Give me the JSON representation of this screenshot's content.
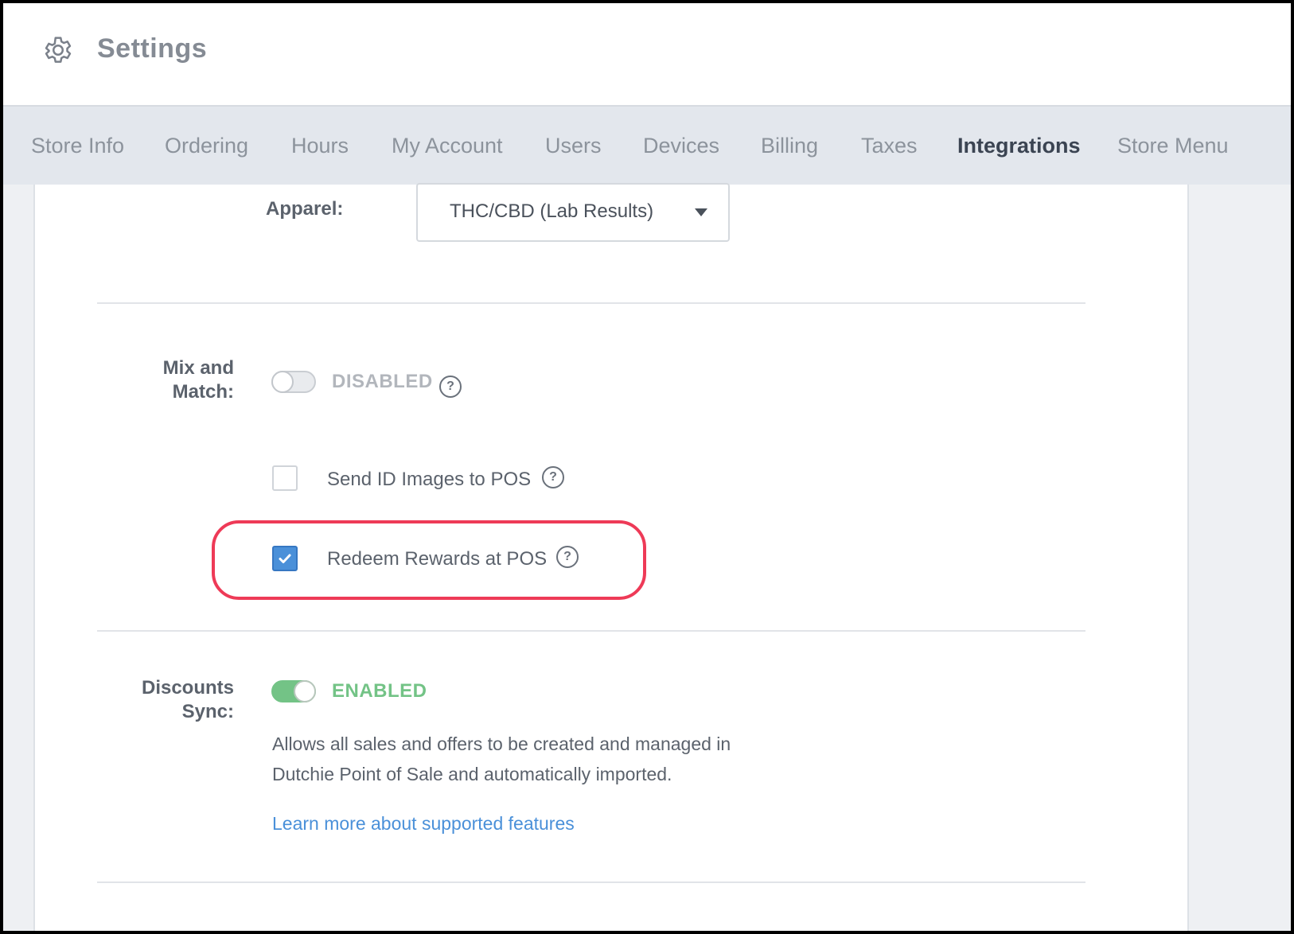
{
  "header": {
    "title": "Settings",
    "icon": "gear-icon"
  },
  "tabs": [
    {
      "label": "Store Info",
      "active": false
    },
    {
      "label": "Ordering",
      "active": false
    },
    {
      "label": "Hours",
      "active": false
    },
    {
      "label": "My Account",
      "active": false
    },
    {
      "label": "Users",
      "active": false
    },
    {
      "label": "Devices",
      "active": false
    },
    {
      "label": "Billing",
      "active": false
    },
    {
      "label": "Taxes",
      "active": false
    },
    {
      "label": "Integrations",
      "active": true
    },
    {
      "label": "Store Menu",
      "active": false
    }
  ],
  "apparel": {
    "label": "Apparel:",
    "selected": "THC/CBD (Lab Results)"
  },
  "mix_match": {
    "label_line1": "Mix and",
    "label_line2": "Match:",
    "status": "DISABLED",
    "enabled": false,
    "help": "?"
  },
  "send_id": {
    "label": "Send ID Images to POS",
    "checked": false,
    "help": "?"
  },
  "redeem_rewards": {
    "label": "Redeem Rewards at POS",
    "checked": true,
    "help": "?"
  },
  "discounts_sync": {
    "label_line1": "Discounts",
    "label_line2": "Sync:",
    "status": "ENABLED",
    "enabled": true,
    "description_line1": "Allows all sales and offers to be created and managed in",
    "description_line2": "Dutchie Point of Sale and automatically imported.",
    "link": "Learn more about supported features"
  },
  "colors": {
    "accent_blue": "#4a90d9",
    "enabled_green": "#73c386",
    "disabled_gray": "#b2b6bc",
    "highlight_red": "#ee3a57"
  }
}
